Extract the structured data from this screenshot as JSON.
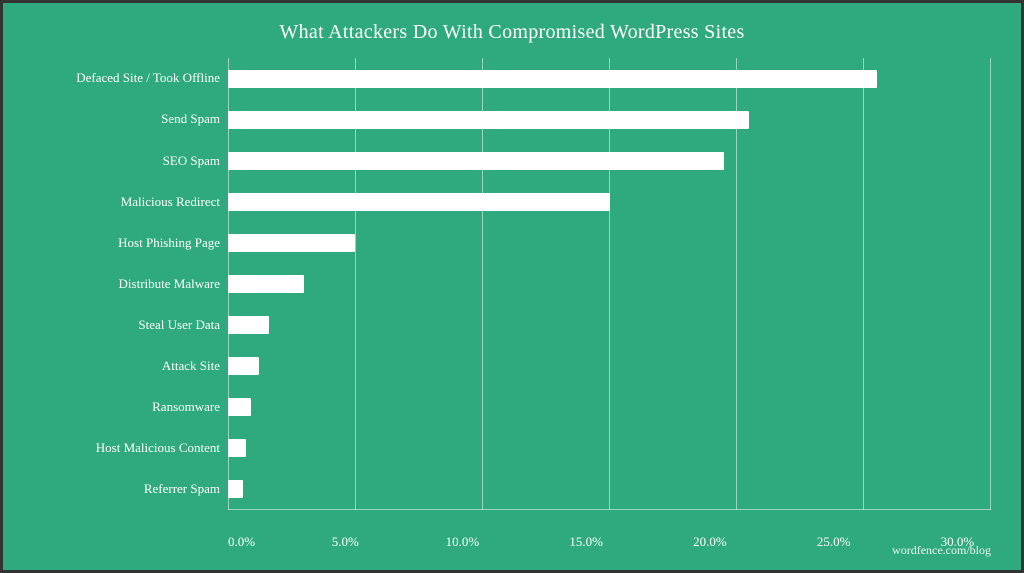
{
  "chart": {
    "title": "What Attackers Do With Compromised WordPress Sites",
    "watermark": "wordfence.com/blog",
    "bars": [
      {
        "label": "Defaced Site / Took Offline",
        "value": 25.5,
        "pct": 85.0
      },
      {
        "label": "Send Spam",
        "value": 20.5,
        "pct": 68.3
      },
      {
        "label": "SEO Spam",
        "value": 19.5,
        "pct": 65.0
      },
      {
        "label": "Malicious Redirect",
        "value": 15.0,
        "pct": 50.0
      },
      {
        "label": "Host Phishing Page",
        "value": 5.0,
        "pct": 16.7
      },
      {
        "label": "Distribute Malware",
        "value": 3.0,
        "pct": 10.0
      },
      {
        "label": "Steal User Data",
        "value": 1.6,
        "pct": 5.3
      },
      {
        "label": "Attack Site",
        "value": 1.2,
        "pct": 4.0
      },
      {
        "label": "Ransomware",
        "value": 0.9,
        "pct": 3.0
      },
      {
        "label": "Host Malicious Content",
        "value": 0.7,
        "pct": 2.3
      },
      {
        "label": "Referrer Spam",
        "value": 0.6,
        "pct": 2.0
      }
    ],
    "x_labels": [
      "0.0%",
      "5.0%",
      "10.0%",
      "15.0%",
      "20.0%",
      "25.0%",
      "30.0%"
    ],
    "x_max": 30.0
  }
}
